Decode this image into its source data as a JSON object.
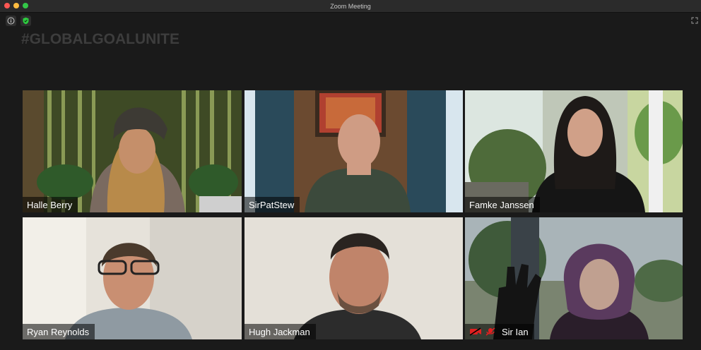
{
  "window": {
    "title": "Zoom Meeting"
  },
  "banner": {
    "hashtag": "#GLOBALGOALUNITE"
  },
  "participants": [
    {
      "name": "Halle Berry"
    },
    {
      "name": "SirPatStew"
    },
    {
      "name": "Famke Janssen"
    },
    {
      "name": "Ryan Reynolds"
    },
    {
      "name": "Hugh Jackman"
    },
    {
      "name": "Sir Ian"
    }
  ],
  "icons": {
    "info": "info-icon",
    "security": "shield-icon",
    "fullscreen": "fullscreen-icon",
    "mic_muted": "muted-mic-icon",
    "video_muted": "muted-video-icon"
  },
  "colors": {
    "background": "#1a1a1a",
    "titlebar": "#2b2b2b",
    "security_green": "#2ecc40",
    "muted_red": "#e02020"
  }
}
